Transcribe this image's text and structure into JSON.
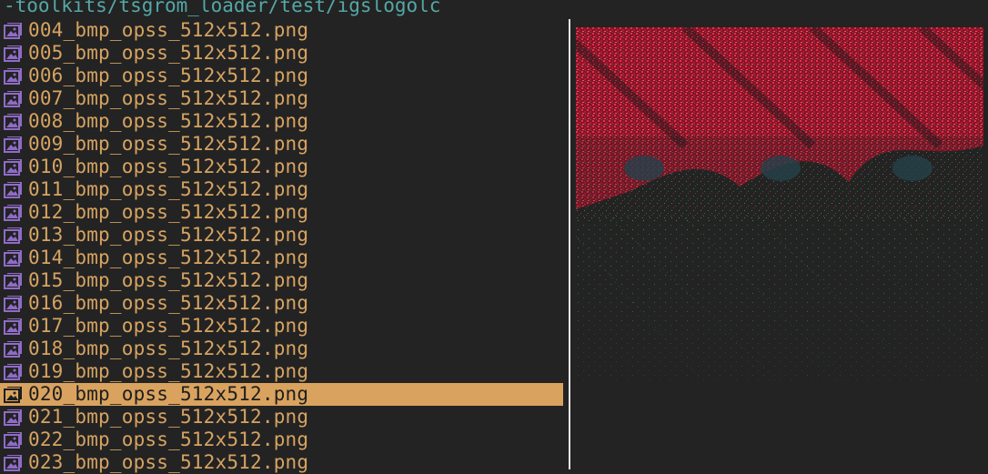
{
  "path": "-toolkits/tsgrom_loader/test/igslogolc",
  "files": [
    {
      "name": "004_bmp_opss_512x512.png"
    },
    {
      "name": "005_bmp_opss_512x512.png"
    },
    {
      "name": "006_bmp_opss_512x512.png"
    },
    {
      "name": "007_bmp_opss_512x512.png"
    },
    {
      "name": "008_bmp_opss_512x512.png"
    },
    {
      "name": "009_bmp_opss_512x512.png"
    },
    {
      "name": "010_bmp_opss_512x512.png"
    },
    {
      "name": "011_bmp_opss_512x512.png"
    },
    {
      "name": "012_bmp_opss_512x512.png"
    },
    {
      "name": "013_bmp_opss_512x512.png"
    },
    {
      "name": "014_bmp_opss_512x512.png"
    },
    {
      "name": "015_bmp_opss_512x512.png"
    },
    {
      "name": "016_bmp_opss_512x512.png"
    },
    {
      "name": "017_bmp_opss_512x512.png"
    },
    {
      "name": "018_bmp_opss_512x512.png"
    },
    {
      "name": "019_bmp_opss_512x512.png"
    },
    {
      "name": "020_bmp_opss_512x512.png",
      "selected": true
    },
    {
      "name": "021_bmp_opss_512x512.png"
    },
    {
      "name": "022_bmp_opss_512x512.png"
    },
    {
      "name": "023_bmp_opss_512x512.png"
    }
  ],
  "colors": {
    "background": "#232323",
    "path_text": "#55a7a7",
    "file_text": "#d7a361",
    "selection": "#d9a35f",
    "icon": "#8f6cc7",
    "divider": "#e6e6e6"
  },
  "icon_name": "image-file-icon"
}
